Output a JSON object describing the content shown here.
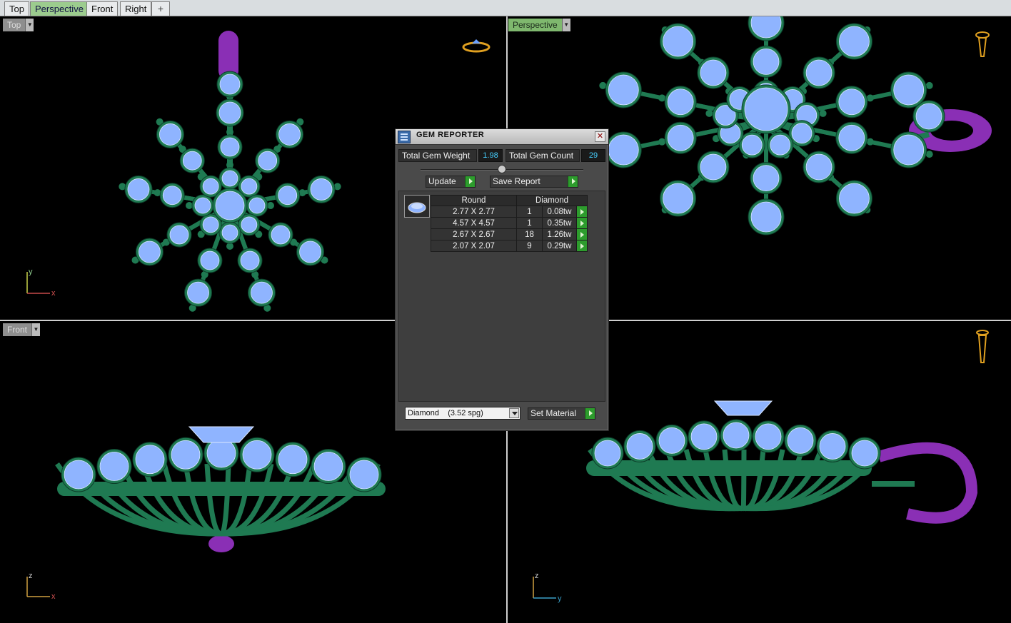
{
  "tabs": [
    {
      "label": "Top",
      "active": false
    },
    {
      "label": "Perspective",
      "active": true
    },
    {
      "label": "Front",
      "active": false
    },
    {
      "label": "Right",
      "active": false
    }
  ],
  "tab_add": "+",
  "viewports": {
    "top": {
      "label": "Top",
      "axes": [
        "y",
        "x"
      ]
    },
    "perspective": {
      "label": "Perspective"
    },
    "front": {
      "label": "Front",
      "axes": [
        "z",
        "x"
      ]
    },
    "right": {
      "axes": [
        "z",
        "y"
      ]
    }
  },
  "colors": {
    "metal": "#1f7a52",
    "gem": "#8fb4ff",
    "bail": "#8a2fb5",
    "viewport_bg": "#000000",
    "active_tab": "#9ccc8e"
  },
  "gem_reporter": {
    "title": "GEM REPORTER",
    "total_weight_label": "Total Gem Weight",
    "total_weight_value": "1.98",
    "total_count_label": "Total Gem Count",
    "total_count_value": "29",
    "update_label": "Update",
    "save_report_label": "Save Report",
    "table": {
      "headers": [
        "Round",
        "Diamond"
      ],
      "rows": [
        {
          "size": "2.77 X 2.77",
          "count": "1",
          "weight": "0.08tw"
        },
        {
          "size": "4.57 X 4.57",
          "count": "1",
          "weight": "0.35tw"
        },
        {
          "size": "2.67 X 2.67",
          "count": "18",
          "weight": "1.26tw"
        },
        {
          "size": "2.07 X 2.07",
          "count": "9",
          "weight": "0.29tw"
        }
      ]
    },
    "material_select": "Diamond    (3.52 spg)",
    "set_material_label": "Set Material"
  }
}
